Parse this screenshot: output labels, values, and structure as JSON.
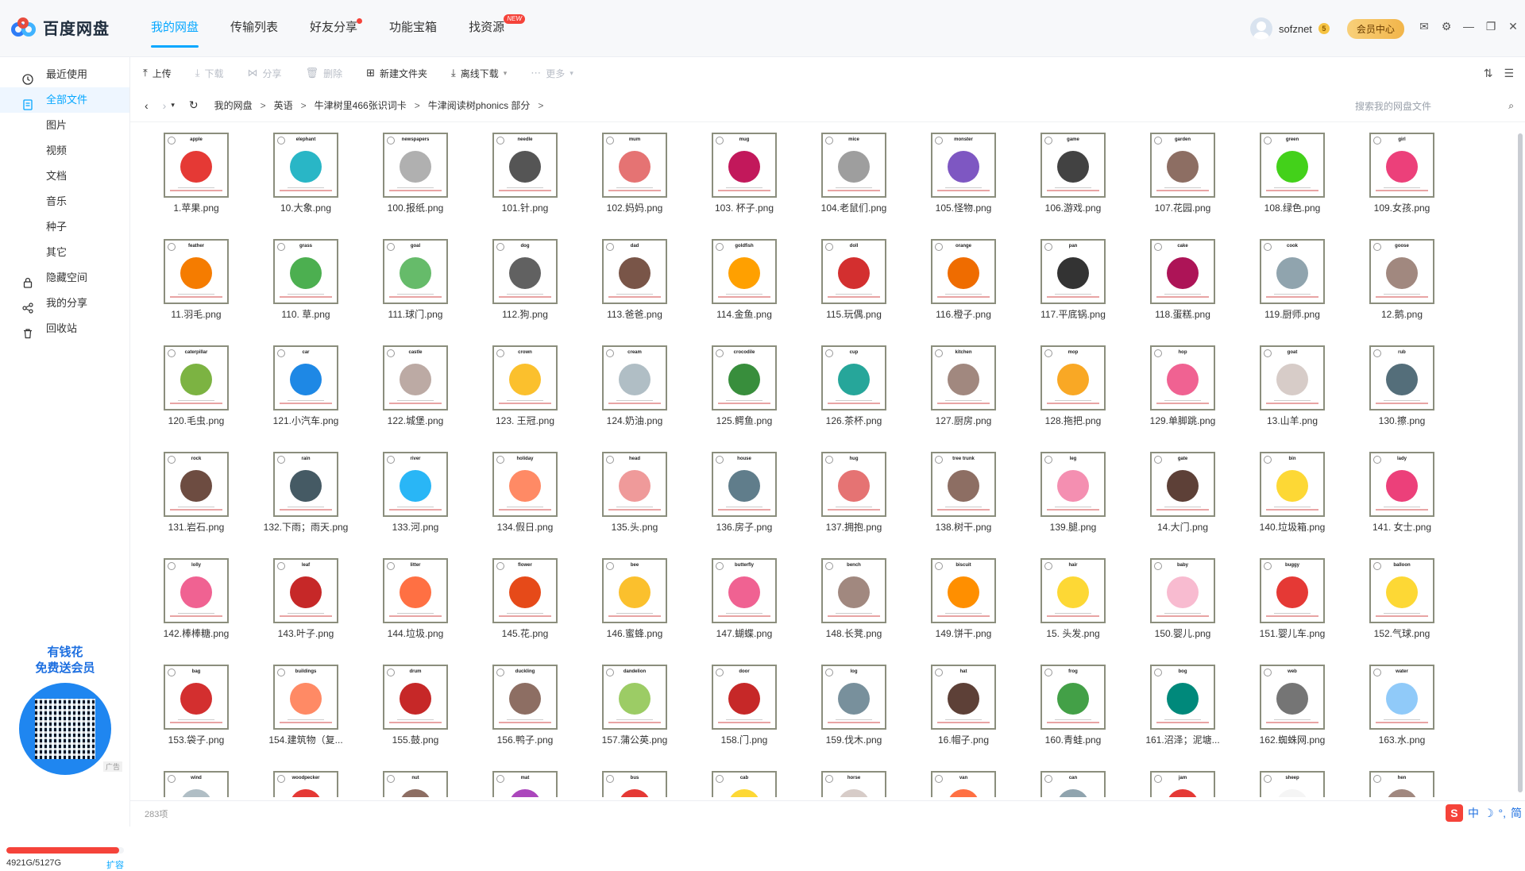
{
  "app": {
    "name": "百度网盘"
  },
  "nav": {
    "tabs": [
      "我的网盘",
      "传输列表",
      "好友分享",
      "功能宝箱",
      "找资源"
    ],
    "new_badge": "NEW"
  },
  "user": {
    "name": "sofznet",
    "coin": "5",
    "vip_label": "会员中心"
  },
  "sidebar": {
    "items": [
      "最近使用",
      "全部文件",
      "图片",
      "视频",
      "文档",
      "音乐",
      "种子",
      "其它",
      "隐藏空间",
      "我的分享",
      "回收站"
    ],
    "promo_line1": "有钱花",
    "promo_line2": "免费送会员",
    "ad_label": "广告",
    "storage_text": "4921G/5127G",
    "storage_used_fraction": 0.96,
    "expand_label": "扩容"
  },
  "toolbar": {
    "upload": "上传",
    "download": "下载",
    "share": "分享",
    "delete": "删除",
    "new_folder": "新建文件夹",
    "offline_download": "离线下载",
    "more": "更多"
  },
  "breadcrumb": [
    "我的网盘",
    "英语",
    "牛津树里466张识词卡",
    "牛津阅读树phonics 部分"
  ],
  "search": {
    "placeholder": "搜索我的网盘文件"
  },
  "files": [
    {
      "name": "1.苹果.png",
      "word": "apple",
      "color": "#e53935"
    },
    {
      "name": "10.大象.png",
      "word": "elephant",
      "color": "#29b6c6"
    },
    {
      "name": "100.报纸.png",
      "word": "newspapers",
      "color": "#b0b0b0"
    },
    {
      "name": "101.针.png",
      "word": "needle",
      "color": "#555555"
    },
    {
      "name": "102.妈妈.png",
      "word": "mum",
      "color": "#e57373"
    },
    {
      "name": "103. 杯子.png",
      "word": "mug",
      "color": "#c2185b"
    },
    {
      "name": "104.老鼠们.png",
      "word": "mice",
      "color": "#9e9e9e"
    },
    {
      "name": "105.怪物.png",
      "word": "monster",
      "color": "#7e57c2"
    },
    {
      "name": "106.游戏.png",
      "word": "game",
      "color": "#424242"
    },
    {
      "name": "107.花园.png",
      "word": "garden",
      "color": "#8d6e63"
    },
    {
      "name": "108.绿色.png",
      "word": "green",
      "color": "#43d11a"
    },
    {
      "name": "109.女孩.png",
      "word": "girl",
      "color": "#ec407a"
    },
    {
      "name": "11.羽毛.png",
      "word": "feather",
      "color": "#f57c00"
    },
    {
      "name": "110. 草.png",
      "word": "grass",
      "color": "#4caf50"
    },
    {
      "name": "111.球门.png",
      "word": "goal",
      "color": "#66bb6a"
    },
    {
      "name": "112.狗.png",
      "word": "dog",
      "color": "#616161"
    },
    {
      "name": "113.爸爸.png",
      "word": "dad",
      "color": "#795548"
    },
    {
      "name": "114.金鱼.png",
      "word": "goldfish",
      "color": "#ffa000"
    },
    {
      "name": "115.玩偶.png",
      "word": "doll",
      "color": "#d32f2f"
    },
    {
      "name": "116.橙子.png",
      "word": "orange",
      "color": "#ef6c00"
    },
    {
      "name": "117.平底锅.png",
      "word": "pan",
      "color": "#333333"
    },
    {
      "name": "118.蛋糕.png",
      "word": "cake",
      "color": "#ad1457"
    },
    {
      "name": "119.厨师.png",
      "word": "cook",
      "color": "#90a4ae"
    },
    {
      "name": "12.鹅.png",
      "word": "goose",
      "color": "#a1887f"
    },
    {
      "name": "120.毛虫.png",
      "word": "caterpillar",
      "color": "#7cb342"
    },
    {
      "name": "121.小汽车.png",
      "word": "car",
      "color": "#1e88e5"
    },
    {
      "name": "122.城堡.png",
      "word": "castle",
      "color": "#bcaaa4"
    },
    {
      "name": "123. 王冠.png",
      "word": "crown",
      "color": "#fbc02d"
    },
    {
      "name": "124.奶油.png",
      "word": "cream",
      "color": "#b0bec5"
    },
    {
      "name": "125.鳄鱼.png",
      "word": "crocodile",
      "color": "#388e3c"
    },
    {
      "name": "126.茶杯.png",
      "word": "cup",
      "color": "#26a69a"
    },
    {
      "name": "127.厨房.png",
      "word": "kitchen",
      "color": "#a1887f"
    },
    {
      "name": "128.拖把.png",
      "word": "mop",
      "color": "#f9a825"
    },
    {
      "name": "129.单脚跳.png",
      "word": "hop",
      "color": "#f06292"
    },
    {
      "name": "13.山羊.png",
      "word": "goat",
      "color": "#d7ccc8"
    },
    {
      "name": "130.擦.png",
      "word": "rub",
      "color": "#546e7a"
    },
    {
      "name": "131.岩石.png",
      "word": "rock",
      "color": "#6d4c41"
    },
    {
      "name": "132.下雨；雨天.png",
      "word": "rain",
      "color": "#455a64"
    },
    {
      "name": "133.河.png",
      "word": "river",
      "color": "#29b6f6"
    },
    {
      "name": "134.假日.png",
      "word": "holiday",
      "color": "#ff8a65"
    },
    {
      "name": "135.头.png",
      "word": "head",
      "color": "#ef9a9a"
    },
    {
      "name": "136.房子.png",
      "word": "house",
      "color": "#607d8b"
    },
    {
      "name": "137.拥抱.png",
      "word": "hug",
      "color": "#e57373"
    },
    {
      "name": "138.树干.png",
      "word": "tree trunk",
      "color": "#8d6e63"
    },
    {
      "name": "139.腿.png",
      "word": "leg",
      "color": "#f48fb1"
    },
    {
      "name": "14.大门.png",
      "word": "gate",
      "color": "#5d4037"
    },
    {
      "name": "140.垃圾箱.png",
      "word": "bin",
      "color": "#fdd835"
    },
    {
      "name": "141. 女士.png",
      "word": "lady",
      "color": "#ec407a"
    },
    {
      "name": "142.棒棒糖.png",
      "word": "lolly",
      "color": "#f06292"
    },
    {
      "name": "143.叶子.png",
      "word": "leaf",
      "color": "#c62828"
    },
    {
      "name": "144.垃圾.png",
      "word": "litter",
      "color": "#ff7043"
    },
    {
      "name": "145.花.png",
      "word": "flower",
      "color": "#e64a19"
    },
    {
      "name": "146.蜜蜂.png",
      "word": "bee",
      "color": "#fbc02d"
    },
    {
      "name": "147.蝴蝶.png",
      "word": "butterfly",
      "color": "#f06292"
    },
    {
      "name": "148.长凳.png",
      "word": "bench",
      "color": "#a1887f"
    },
    {
      "name": "149.饼干.png",
      "word": "biscuit",
      "color": "#ff8f00"
    },
    {
      "name": "15. 头发.png",
      "word": "hair",
      "color": "#fdd835"
    },
    {
      "name": "150.婴儿.png",
      "word": "baby",
      "color": "#f8bbd0"
    },
    {
      "name": "151.婴儿车.png",
      "word": "buggy",
      "color": "#e53935"
    },
    {
      "name": "152.气球.png",
      "word": "balloon",
      "color": "#fdd835"
    },
    {
      "name": "153.袋子.png",
      "word": "bag",
      "color": "#d32f2f"
    },
    {
      "name": "154.建筑物（复...",
      "word": "buildings",
      "color": "#ff8a65"
    },
    {
      "name": "155.鼓.png",
      "word": "drum",
      "color": "#c62828"
    },
    {
      "name": "156.鸭子.png",
      "word": "duckling",
      "color": "#8d6e63"
    },
    {
      "name": "157.蒲公英.png",
      "word": "dandelion",
      "color": "#9ccc65"
    },
    {
      "name": "158.门.png",
      "word": "door",
      "color": "#c62828"
    },
    {
      "name": "159.伐木.png",
      "word": "log",
      "color": "#78909c"
    },
    {
      "name": "16.帽子.png",
      "word": "hat",
      "color": "#5d4037"
    },
    {
      "name": "160.青蛙.png",
      "word": "frog",
      "color": "#43a047"
    },
    {
      "name": "161.沼泽；泥塘...",
      "word": "bog",
      "color": "#00897b"
    },
    {
      "name": "162.蜘蛛网.png",
      "word": "web",
      "color": "#757575"
    },
    {
      "name": "163.水.png",
      "word": "water",
      "color": "#90caf9"
    },
    {
      "name": "",
      "word": "wind",
      "color": "#b0bec5"
    },
    {
      "name": "",
      "word": "woodpecker",
      "color": "#e53935"
    },
    {
      "name": "",
      "word": "nut",
      "color": "#8d6e63"
    },
    {
      "name": "",
      "word": "mat",
      "color": "#ab47bc"
    },
    {
      "name": "",
      "word": "bus",
      "color": "#e53935"
    },
    {
      "name": "",
      "word": "cab",
      "color": "#fdd835"
    },
    {
      "name": "",
      "word": "horse",
      "color": "#d7ccc8"
    },
    {
      "name": "",
      "word": "van",
      "color": "#ff7043"
    },
    {
      "name": "",
      "word": "can",
      "color": "#90a4ae"
    },
    {
      "name": "",
      "word": "jam",
      "color": "#e53935"
    },
    {
      "name": "",
      "word": "sheep",
      "color": "#f5f5f5"
    },
    {
      "name": "",
      "word": "hen",
      "color": "#a1887f"
    }
  ],
  "status": {
    "count": "283项"
  },
  "ime": {
    "s": "S",
    "label": "中",
    "moon": "☽",
    "dot": "°,",
    "simp": "简"
  }
}
